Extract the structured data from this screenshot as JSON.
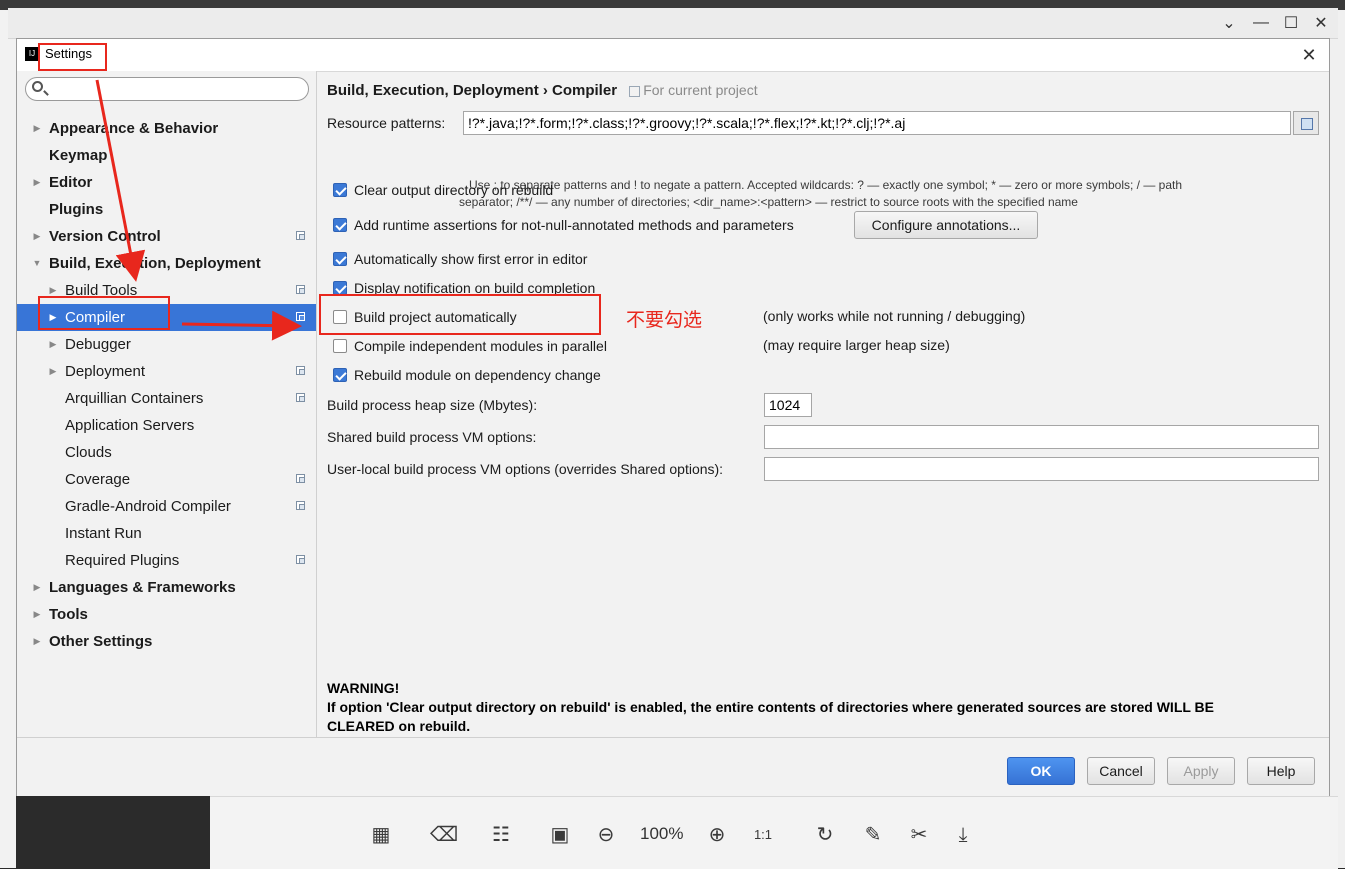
{
  "dialog": {
    "title": "Settings",
    "close_icon": "close-icon"
  },
  "search": {
    "placeholder": "",
    "icon": "search-icon"
  },
  "tree": [
    {
      "label": "Appearance & Behavior",
      "bold": true,
      "arrow": "collapsed",
      "level": 0,
      "project": false
    },
    {
      "label": "Keymap",
      "bold": true,
      "arrow": "none",
      "level": 0,
      "project": false
    },
    {
      "label": "Editor",
      "bold": true,
      "arrow": "collapsed",
      "level": 0,
      "project": false
    },
    {
      "label": "Plugins",
      "bold": true,
      "arrow": "none",
      "level": 0,
      "project": false
    },
    {
      "label": "Version Control",
      "bold": true,
      "arrow": "collapsed",
      "level": 0,
      "project": true
    },
    {
      "label": "Build, Execution, Deployment",
      "bold": true,
      "arrow": "expanded",
      "level": 0,
      "project": false
    },
    {
      "label": "Build Tools",
      "bold": false,
      "arrow": "collapsed",
      "level": 1,
      "project": true
    },
    {
      "label": "Compiler",
      "bold": false,
      "arrow": "collapsed",
      "level": 1,
      "project": true,
      "selected": true
    },
    {
      "label": "Debugger",
      "bold": false,
      "arrow": "collapsed",
      "level": 1,
      "project": false
    },
    {
      "label": "Deployment",
      "bold": false,
      "arrow": "collapsed",
      "level": 1,
      "project": true
    },
    {
      "label": "Arquillian Containers",
      "bold": false,
      "arrow": "none",
      "level": 1,
      "project": true
    },
    {
      "label": "Application Servers",
      "bold": false,
      "arrow": "none",
      "level": 1,
      "project": false
    },
    {
      "label": "Clouds",
      "bold": false,
      "arrow": "none",
      "level": 1,
      "project": false
    },
    {
      "label": "Coverage",
      "bold": false,
      "arrow": "none",
      "level": 1,
      "project": true
    },
    {
      "label": "Gradle-Android Compiler",
      "bold": false,
      "arrow": "none",
      "level": 1,
      "project": true
    },
    {
      "label": "Instant Run",
      "bold": false,
      "arrow": "none",
      "level": 1,
      "project": false
    },
    {
      "label": "Required Plugins",
      "bold": false,
      "arrow": "none",
      "level": 1,
      "project": true
    },
    {
      "label": "Languages & Frameworks",
      "bold": true,
      "arrow": "collapsed",
      "level": 0,
      "project": false
    },
    {
      "label": "Tools",
      "bold": true,
      "arrow": "collapsed",
      "level": 0,
      "project": false
    },
    {
      "label": "Other Settings",
      "bold": true,
      "arrow": "collapsed",
      "level": 0,
      "project": false
    }
  ],
  "content": {
    "breadcrumb": "Build, Execution, Deployment › Compiler",
    "breadcrumb_scope": "For current project",
    "resource_patterns_label": "Resource patterns:",
    "resource_patterns_value": "!?*.java;!?*.form;!?*.class;!?*.groovy;!?*.scala;!?*.flex;!?*.kt;!?*.clj;!?*.aj",
    "hint_line1": "Use ; to separate patterns and ! to negate a pattern. Accepted wildcards: ? — exactly one symbol; * — zero or more symbols; / — path",
    "hint_line2": "separator; /**/ — any number of directories; <dir_name>:<pattern> — restrict to source roots with the specified name",
    "checkboxes": [
      {
        "label": "Clear output directory on rebuild",
        "checked": true
      },
      {
        "label": "Add runtime assertions for not-null-annotated methods and parameters",
        "checked": true
      },
      {
        "label": "Automatically show first error in editor",
        "checked": true
      },
      {
        "label": "Display notification on build completion",
        "checked": true
      },
      {
        "label": "Build project automatically",
        "checked": false
      },
      {
        "label": "Compile independent modules in parallel",
        "checked": false
      },
      {
        "label": "Rebuild module on dependency change",
        "checked": true
      }
    ],
    "configure_annotations_button": "Configure annotations...",
    "note_build_auto": "(only works while not running / debugging)",
    "note_parallel": "(may require larger heap size)",
    "heap_size_label": "Build process heap size (Mbytes):",
    "heap_size_value": "1024",
    "shared_vm_label": "Shared build process VM options:",
    "shared_vm_value": "",
    "user_vm_label": "User-local build process VM options (overrides Shared options):",
    "user_vm_value": "",
    "warning_title": "WARNING!",
    "warning_line1": "If option 'Clear output directory on rebuild' is enabled, the entire contents of directories where generated sources are stored WILL BE",
    "warning_line2": "CLEARED on rebuild."
  },
  "footer": {
    "ok": "OK",
    "cancel": "Cancel",
    "apply": "Apply",
    "help": "Help"
  },
  "annotation": {
    "text": "不要勾选",
    "color": "#e8271d"
  },
  "viewer_toolbar": {
    "zoom": "100%",
    "icons": [
      "layout-icon",
      "fit-text-icon",
      "translate-icon",
      "fullscreen-icon",
      "zoom-out-icon",
      "zoom-in-icon",
      "actual-size-icon",
      "rotate-icon",
      "edit-icon",
      "crop-icon",
      "download-icon"
    ]
  },
  "colors": {
    "selection": "#3875d7",
    "primary_button": "#3b79d6",
    "annotation_red": "#e8271d"
  }
}
